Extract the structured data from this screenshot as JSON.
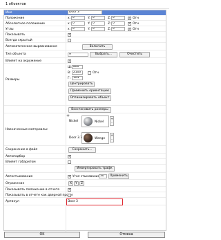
{
  "window": {
    "title": "1 объектов"
  },
  "props": {
    "name_label": "Имя",
    "name_value": "Door 3",
    "position_label": "Положение",
    "abs_position_label": "Абсолютное положение",
    "angles_label": "Углы",
    "show_label": "Показывать",
    "always_hidden_label": "Всегда скрытый",
    "auto_align_label": "Автоматическое выравнивание",
    "object_type_label": "Тип объекта",
    "affects_env_label": "Влияет на окружение",
    "sizes_label": "Размеры",
    "assigned_materials_label": "Назначенные материалы:",
    "save_to_file_label": "Сохранение в файл",
    "autosize_label": "Автоподбор",
    "affects_gabarits_label": "Влияет габаритом",
    "auto_attach_label": "Автостыкование",
    "mirror_label": "Отражение",
    "show_pos_report_label": "Показывать положение в отчете",
    "show_report_door_label": "Показывать в отчете как дверной проем",
    "article_label": "Артикул"
  },
  "position": {
    "x_label": "x:",
    "x_value": "0",
    "y_label": "Y:",
    "y_value": "0",
    "z_label": "Z:",
    "z_value": "0",
    "rel_label": "Отн"
  },
  "abs_position": {
    "x_label": "x:",
    "x_value": "0",
    "y_label": "Y:",
    "y_value": "0",
    "z_label": "Z:",
    "z_value": "0",
    "rel_label": "Отн"
  },
  "angles": {
    "x_label": "x:",
    "x_value": "0",
    "y_label": "Y:",
    "y_value": "0",
    "z_label": "Z:",
    "z_value": "0",
    "rel_label": "Отн"
  },
  "show_checked": "✓",
  "auto_align_button": "Включить",
  "object_type": {
    "value": "9",
    "choose_button": "Выбрать...",
    "clear_button": "Очистить"
  },
  "sizes": {
    "w_label": "Ш:",
    "w_value": "800",
    "h_label": "В:",
    "h_value": "2100",
    "rel_label": "Отн",
    "d_label": "Г:",
    "d_value": "103",
    "center_button": "Центрировать",
    "apply_orient_button": "Применить ориентацию",
    "optimize_button": "Оптимизировать объект",
    "restore_button": "Восстановить размеры"
  },
  "materials": [
    {
      "slot": "Nickel",
      "name": "Nickel",
      "color": "#8e9196"
    },
    {
      "slot": "Door 3.7e",
      "name": "Wenge",
      "color": "#3c2b22"
    }
  ],
  "save_button": "Сохранить...",
  "invert_button": "Инвертировать трафк",
  "auto_attach": {
    "label": "Угол стыкования",
    "value": "30",
    "apply_button": "Применить"
  },
  "mirror": {
    "x": "X",
    "y": "Y",
    "z": "Z"
  },
  "article_value": "Door 3",
  "footer": {
    "ok_label": "OK",
    "cancel_label": "Отмена"
  }
}
